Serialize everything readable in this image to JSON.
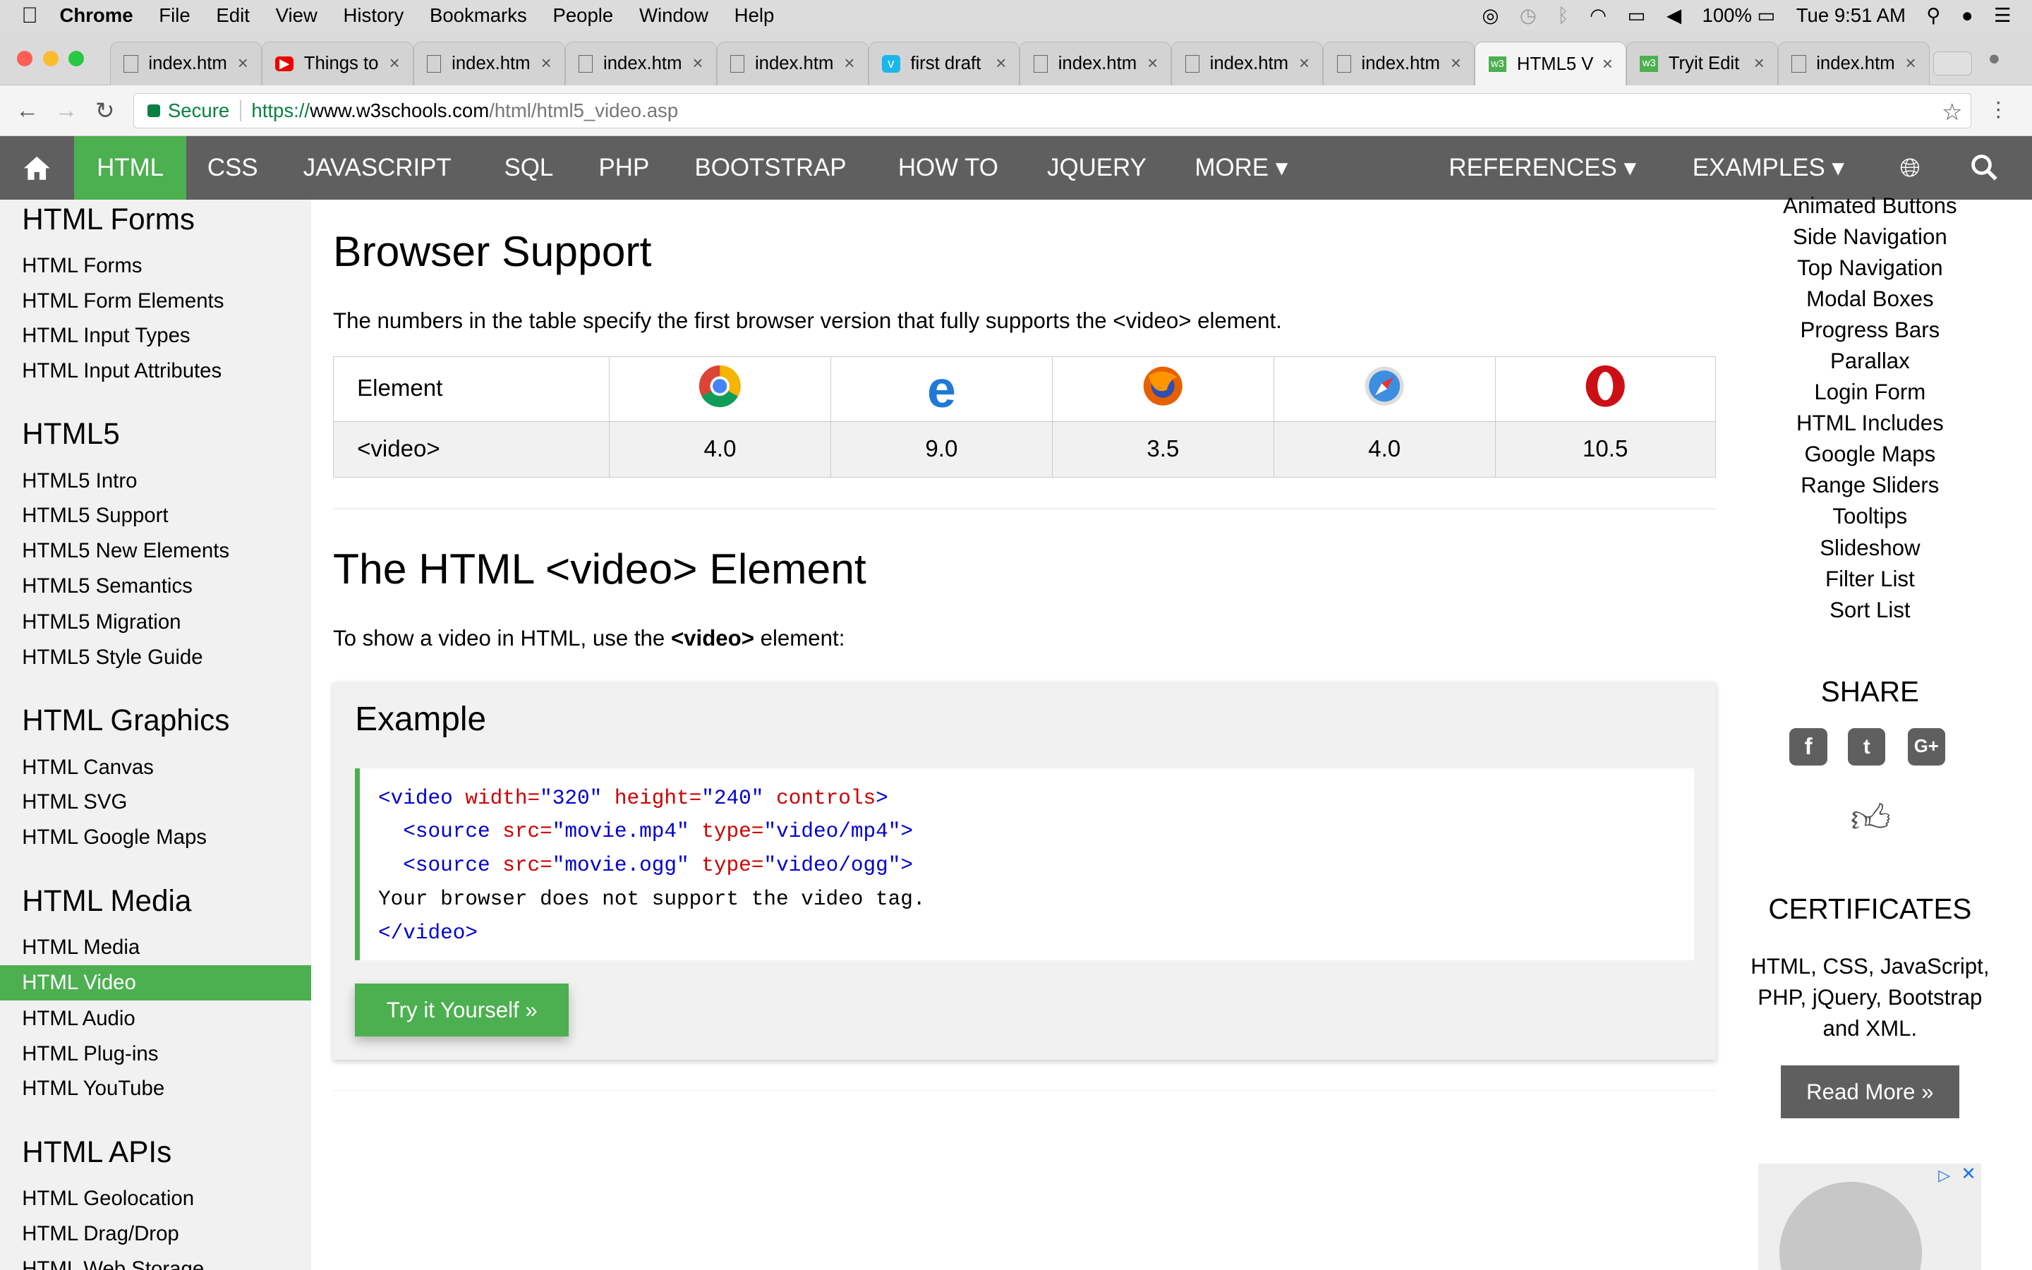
{
  "menubar": {
    "apple_icon": "apple-icon",
    "items": [
      "Chrome",
      "File",
      "Edit",
      "View",
      "History",
      "Bookmarks",
      "People",
      "Window",
      "Help"
    ],
    "battery": "100%",
    "clock": "Tue 9:51 AM"
  },
  "tabs": [
    {
      "title": "index.htm",
      "icon": "file-icon"
    },
    {
      "title": "Things to",
      "icon": "youtube-icon"
    },
    {
      "title": "index.htm",
      "icon": "file-icon"
    },
    {
      "title": "index.htm",
      "icon": "file-icon"
    },
    {
      "title": "index.htm",
      "icon": "file-icon"
    },
    {
      "title": "first draft",
      "icon": "vimeo-icon"
    },
    {
      "title": "index.htm",
      "icon": "file-icon"
    },
    {
      "title": "index.htm",
      "icon": "file-icon"
    },
    {
      "title": "index.htm",
      "icon": "file-icon"
    },
    {
      "title": "HTML5 V",
      "icon": "w3schools-icon",
      "active": true
    },
    {
      "title": "Tryit Edit",
      "icon": "w3schools-icon"
    },
    {
      "title": "index.htm",
      "icon": "file-icon"
    }
  ],
  "address": {
    "secure_label": "Secure",
    "scheme": "https://",
    "host": "www.w3schools.com",
    "path": "/html/html5_video.asp"
  },
  "topnav": {
    "items": [
      "HTML",
      "CSS",
      "JAVASCRIPT",
      "SQL",
      "PHP",
      "BOOTSTRAP",
      "HOW TO",
      "JQUERY",
      "MORE ▾"
    ],
    "right_items": [
      "REFERENCES ▾",
      "EXAMPLES ▾"
    ],
    "active": "HTML",
    "accent": "#4caf50",
    "bg": "#5f5f5f"
  },
  "sidebar": {
    "sections": [
      {
        "heading": "HTML Forms",
        "items": [
          "HTML Forms",
          "HTML Form Elements",
          "HTML Input Types",
          "HTML Input Attributes"
        ]
      },
      {
        "heading": "HTML5",
        "items": [
          "HTML5 Intro",
          "HTML5 Support",
          "HTML5 New Elements",
          "HTML5 Semantics",
          "HTML5 Migration",
          "HTML5 Style Guide"
        ]
      },
      {
        "heading": "HTML Graphics",
        "items": [
          "HTML Canvas",
          "HTML SVG",
          "HTML Google Maps"
        ]
      },
      {
        "heading": "HTML Media",
        "items": [
          "HTML Media",
          "HTML Video",
          "HTML Audio",
          "HTML Plug-ins",
          "HTML YouTube"
        ]
      },
      {
        "heading": "HTML APIs",
        "items": [
          "HTML Geolocation",
          "HTML Drag/Drop",
          "HTML Web Storage"
        ]
      }
    ],
    "active_item": "HTML Video"
  },
  "main": {
    "support_title": "Browser Support",
    "support_desc": "The numbers in the table specify the first browser version that fully supports the <video> element.",
    "table": {
      "header_first": "Element",
      "browser_icons": [
        "chrome-icon",
        "edge-icon",
        "firefox-icon",
        "safari-icon",
        "opera-icon"
      ],
      "row_label": "<video>",
      "values": [
        "4.0",
        "9.0",
        "3.5",
        "4.0",
        "10.5"
      ]
    },
    "video_title": "The HTML <video> Element",
    "video_desc_pre": "To show a video in HTML, use the ",
    "video_desc_bold": "<video>",
    "video_desc_post": " element:",
    "example_title": "Example",
    "code": {
      "l1_tag": "<video",
      "l1_a1": " width=",
      "l1_v1": "\"320\"",
      "l1_a2": " height=",
      "l1_v2": "\"240\"",
      "l1_a3": " controls",
      "l1_end": ">",
      "l2_tag": "  <source",
      "l2_a1": " src=",
      "l2_v1": "\"movie.mp4\"",
      "l2_a2": " type=",
      "l2_v2": "\"video/mp4\"",
      "l2_end": ">",
      "l3_tag": "  <source",
      "l3_a1": " src=",
      "l3_v1": "\"movie.ogg\"",
      "l3_a2": " type=",
      "l3_v2": "\"video/ogg\"",
      "l3_end": ">",
      "l4": "Your browser does not support the video tag.",
      "l5": "</video>"
    },
    "try_button": "Try it Yourself »"
  },
  "right": {
    "links": [
      "Animated Buttons",
      "Side Navigation",
      "Top Navigation",
      "Modal Boxes",
      "Progress Bars",
      "Parallax",
      "Login Form",
      "HTML Includes",
      "Google Maps",
      "Range Sliders",
      "Tooltips",
      "Slideshow",
      "Filter List",
      "Sort List"
    ],
    "share_title": "SHARE",
    "certificates_title": "CERTIFICATES",
    "cert_line1": "HTML, CSS, JavaScript,",
    "cert_line2": "PHP, jQuery, Bootstrap",
    "cert_line3": "and XML.",
    "read_more": "Read More »"
  }
}
